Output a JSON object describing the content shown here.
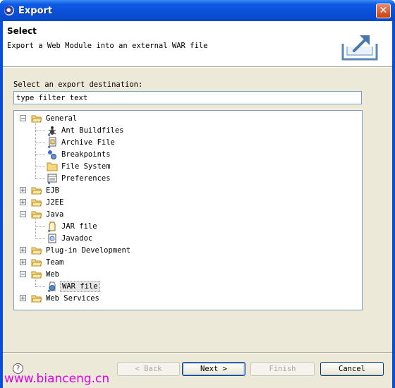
{
  "window": {
    "title": "Export",
    "close_glyph": "✕"
  },
  "header": {
    "title": "Select",
    "description": "Export a Web Module into an external WAR file",
    "graphic_icon": "export-wizard-icon"
  },
  "select_label": "Select an export destination:",
  "filter": {
    "value": "type filter text"
  },
  "tree": {
    "general": "General",
    "general_children": [
      "Ant Buildfiles",
      "Archive File",
      "Breakpoints",
      "File System",
      "Preferences"
    ],
    "ejb": "EJB",
    "j2ee": "J2EE",
    "java": "Java",
    "java_children": [
      "JAR file",
      "Javadoc"
    ],
    "plugin": "Plug-in Development",
    "team": "Team",
    "web": "Web",
    "web_children": [
      "WAR file"
    ],
    "webservices": "Web Services",
    "selected": "WAR file"
  },
  "buttons": {
    "help": "?",
    "back": "< Back",
    "next": "Next >",
    "finish": "Finish",
    "cancel": "Cancel"
  },
  "watermark": "www.bianceng.cn",
  "colors": {
    "title_bar": "#0a4fd6",
    "dialog_bg": "#ece9d8",
    "watermark": "#e000e0"
  }
}
